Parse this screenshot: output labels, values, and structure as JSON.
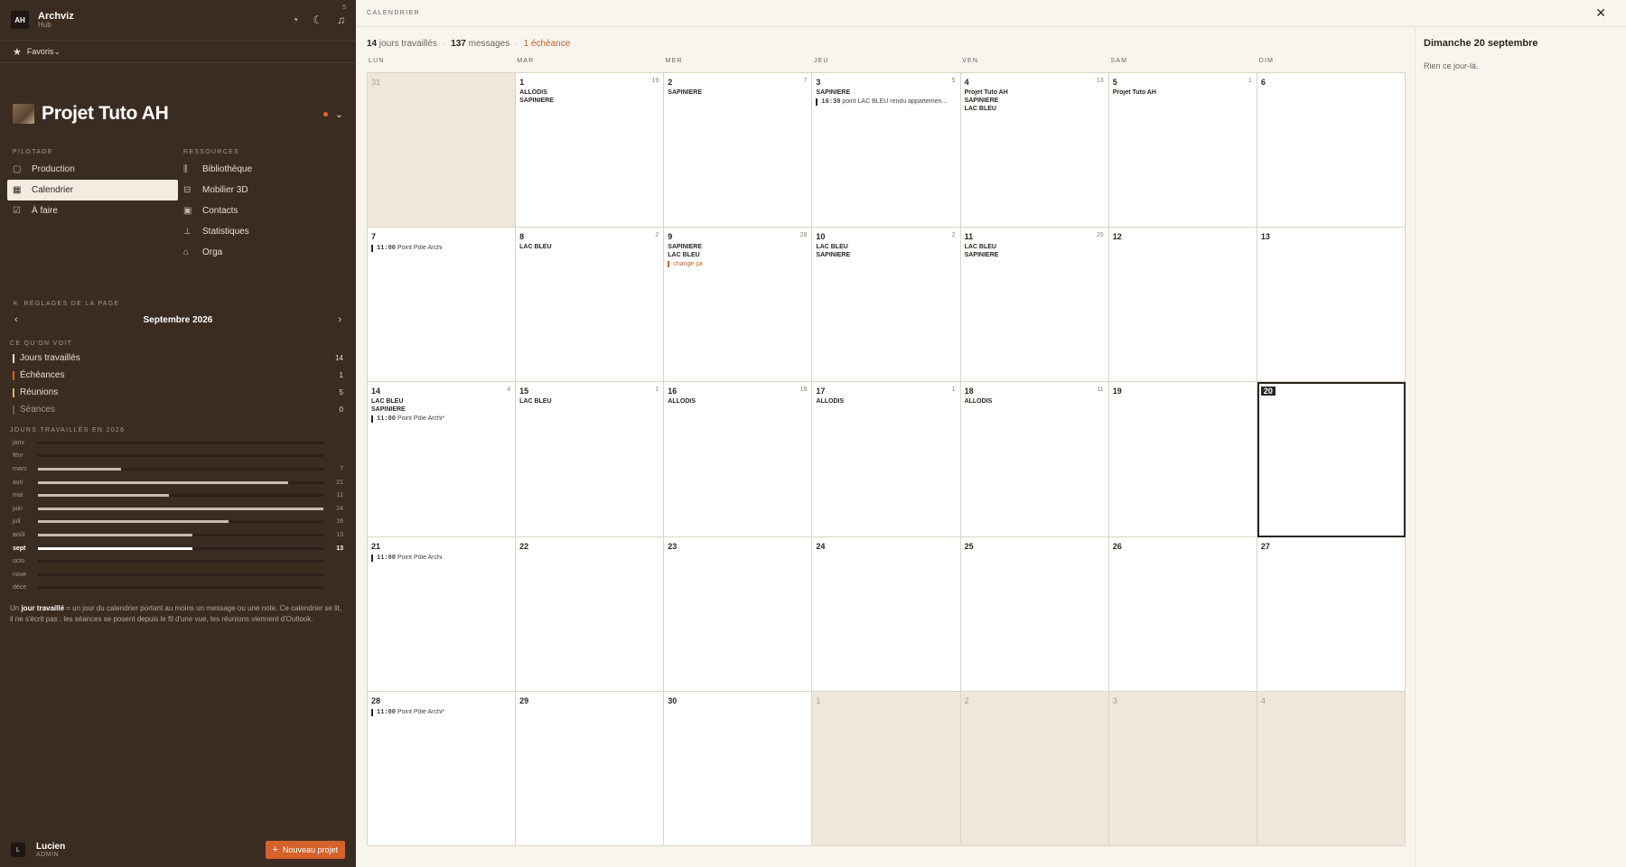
{
  "app": {
    "badge": "AH",
    "name": "Archviz",
    "subtitle": "Hub"
  },
  "header_icons": [
    "palette-icon",
    "moon-icon",
    "bell-icon"
  ],
  "favorites": {
    "label": "Favoris",
    "count": "5"
  },
  "project": {
    "title": "Projet Tuto AH"
  },
  "nav": {
    "pilotage_title": "PILOTAGE",
    "pilotage": [
      {
        "label": "Production",
        "icon": "folder-icon"
      },
      {
        "label": "Calendrier",
        "icon": "calendar-icon",
        "active": true
      },
      {
        "label": "À faire",
        "icon": "todo-icon"
      }
    ],
    "ressources_title": "RESSOURCES",
    "ressources": [
      {
        "label": "Bibliothèque",
        "icon": "library-icon"
      },
      {
        "label": "Mobilier 3D",
        "icon": "furniture-icon"
      },
      {
        "label": "Contacts",
        "icon": "contacts-icon"
      },
      {
        "label": "Statistiques",
        "icon": "stats-icon"
      },
      {
        "label": "Orga",
        "icon": "org-icon"
      }
    ]
  },
  "settings": {
    "title": "RÉGLAGES DE LA PAGE",
    "month": "Septembre 2026"
  },
  "visible": {
    "title": "CE QU'ON VOIT",
    "items": [
      {
        "label": "Jours travaillés",
        "count": "14",
        "color": "#e8ddd0"
      },
      {
        "label": "Échéances",
        "count": "1",
        "color": "#d4622a"
      },
      {
        "label": "Réunions",
        "count": "5",
        "color": "#d9b27a"
      },
      {
        "label": "Séances",
        "count": "0",
        "color": "#6b5a4c"
      }
    ]
  },
  "year": {
    "title": "JOURS TRAVAILLÉS EN 2026",
    "months": [
      {
        "label": "janv",
        "value": 0,
        "display": ""
      },
      {
        "label": "févr",
        "value": 0,
        "display": ""
      },
      {
        "label": "mars",
        "value": 7,
        "display": "7"
      },
      {
        "label": "avri",
        "value": 21,
        "display": "21"
      },
      {
        "label": "mai",
        "value": 11,
        "display": "11"
      },
      {
        "label": "juin",
        "value": 24,
        "display": "24"
      },
      {
        "label": "juil",
        "value": 16,
        "display": "16"
      },
      {
        "label": "août",
        "value": 13,
        "display": "13"
      },
      {
        "label": "sept",
        "value": 13,
        "display": "13",
        "current": true
      },
      {
        "label": "octo",
        "value": 0,
        "display": ""
      },
      {
        "label": "nove",
        "value": 0,
        "display": ""
      },
      {
        "label": "déce",
        "value": 0,
        "display": ""
      }
    ],
    "max": 24
  },
  "note": {
    "pre": "Un ",
    "bold": "jour travaillé",
    "post": " = un jour du calendrier portant au moins un message ou une note. Ce calendrier se lit, il ne s'écrit pas : les séances se posent depuis le fil d'une vue, les réunions viennent d'Outlook."
  },
  "user": {
    "initial": "L",
    "name": "Lucien",
    "role": "ADMIN"
  },
  "new_project": "Nouveau projet",
  "main": {
    "title": "CALENDRIER",
    "stats": {
      "days": "14",
      "days_label": "jours travaillés",
      "messages": "137",
      "messages_label": "messages",
      "echeance": "1 échéance"
    },
    "dow": [
      "LUN",
      "MAR",
      "MER",
      "JEU",
      "VEN",
      "SAM",
      "DIM"
    ],
    "days": [
      {
        "n": "31",
        "out": true
      },
      {
        "n": "1",
        "count": "19",
        "events": [
          "ALLODIS",
          "SAPINIERE"
        ]
      },
      {
        "n": "2",
        "count": "7",
        "events": [
          "SAPINIERE"
        ]
      },
      {
        "n": "3",
        "count": "5",
        "events": [
          "SAPINIERE"
        ],
        "meets": [
          {
            "time": "16:30",
            "text": "point LAC BLEU rendu appartemen..."
          }
        ]
      },
      {
        "n": "4",
        "count": "13",
        "events": [
          "Projet Tuto AH",
          "SAPINIERE",
          "LAC BLEU"
        ]
      },
      {
        "n": "5",
        "count": "1",
        "events": [
          "Projet Tuto AH"
        ]
      },
      {
        "n": "6"
      },
      {
        "n": "7",
        "meets": [
          {
            "time": "11:00",
            "text": "Point Pôle Archi"
          }
        ]
      },
      {
        "n": "8",
        "count": "2",
        "events": [
          "LAC BLEU"
        ]
      },
      {
        "n": "9",
        "count": "28",
        "events": [
          "SAPINIERE",
          "LAC BLEU"
        ],
        "deadlines": [
          "change ça"
        ]
      },
      {
        "n": "10",
        "count": "2",
        "events": [
          "LAC BLEU",
          "SAPINIERE"
        ]
      },
      {
        "n": "11",
        "count": "25",
        "events": [
          "LAC BLEU",
          "SAPINIERE"
        ]
      },
      {
        "n": "12"
      },
      {
        "n": "13"
      },
      {
        "n": "14",
        "count": "4",
        "events": [
          "LAC BLEU",
          "SAPINIERE"
        ],
        "meets": [
          {
            "time": "11:00",
            "text": "Point Pôle Archi*"
          }
        ]
      },
      {
        "n": "15",
        "count": "1",
        "events": [
          "LAC BLEU"
        ]
      },
      {
        "n": "16",
        "count": "18",
        "events": [
          "ALLODIS"
        ]
      },
      {
        "n": "17",
        "count": "1",
        "events": [
          "ALLODIS"
        ]
      },
      {
        "n": "18",
        "count": "11",
        "events": [
          "ALLODIS"
        ]
      },
      {
        "n": "19"
      },
      {
        "n": "20",
        "today": true
      },
      {
        "n": "21",
        "meets": [
          {
            "time": "11:00",
            "text": "Point Pôle Archi"
          }
        ]
      },
      {
        "n": "22"
      },
      {
        "n": "23"
      },
      {
        "n": "24"
      },
      {
        "n": "25"
      },
      {
        "n": "26"
      },
      {
        "n": "27"
      },
      {
        "n": "28",
        "meets": [
          {
            "time": "11:00",
            "text": "Point Pôle Archi*"
          }
        ]
      },
      {
        "n": "29"
      },
      {
        "n": "30"
      },
      {
        "n": "1",
        "out": true
      },
      {
        "n": "2",
        "out": true
      },
      {
        "n": "3",
        "out": true
      },
      {
        "n": "4",
        "out": true
      }
    ]
  },
  "detail": {
    "date": "Dimanche 20 septembre",
    "empty": "Rien ce jour-là."
  },
  "colors": {
    "sidebar": "#3b2c22",
    "accent": "#d4622a",
    "main_bg": "#f8f5ee"
  }
}
